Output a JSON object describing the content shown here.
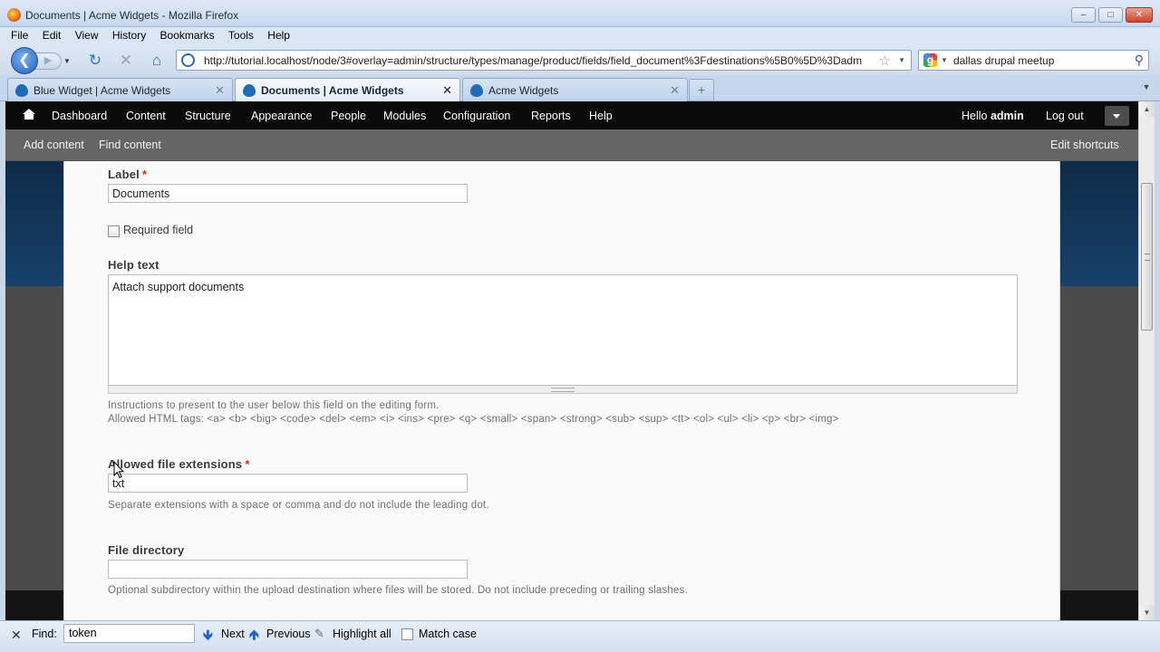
{
  "window": {
    "title": "Documents | Acme Widgets - Mozilla Firefox",
    "controls": [
      "–",
      "□",
      "✕"
    ]
  },
  "menubar": [
    "File",
    "Edit",
    "View",
    "History",
    "Bookmarks",
    "Tools",
    "Help"
  ],
  "navbar": {
    "url": "http://tutorial.localhost/node/3#overlay=admin/structure/types/manage/product/fields/field_document%3Fdestinations%5B0%5D%3Dadm",
    "search_text": "dallas drupal meetup"
  },
  "tabs": [
    {
      "label": "Blue Widget | Acme Widgets",
      "active": false
    },
    {
      "label": "Documents | Acme Widgets",
      "active": true
    },
    {
      "label": "Acme Widgets",
      "active": false
    }
  ],
  "admin_toolbar": {
    "items": [
      "Dashboard",
      "Content",
      "Structure",
      "Appearance",
      "People",
      "Modules",
      "Configuration",
      "Reports",
      "Help"
    ],
    "hello_prefix": "Hello ",
    "username": "admin",
    "logout": "Log out"
  },
  "shortcuts": {
    "items": [
      "Add content",
      "Find content"
    ],
    "edit": "Edit shortcuts"
  },
  "form": {
    "label_title": "Label",
    "label_value": "Documents",
    "required_field_label": "Required field",
    "help_text_title": "Help text",
    "help_text_value": "Attach support documents",
    "help_desc_line1": "Instructions to present to the user below this field on the editing form.",
    "help_desc_line2": "Allowed HTML tags: <a> <b> <big> <code> <del> <em> <i> <ins> <pre> <q> <small> <span> <strong> <sub> <sup> <tt> <ol> <ul> <li> <p> <br> <img>",
    "extensions_title": "Allowed file extensions",
    "extensions_value": "txt",
    "extensions_desc": "Separate extensions with a space or comma and do not include the leading dot.",
    "directory_title": "File directory",
    "directory_value": "",
    "directory_desc": "Optional subdirectory within the upload destination where files will be stored. Do not include preceding or trailing slashes.",
    "required_marker": "*"
  },
  "findbar": {
    "label": "Find:",
    "query": "token",
    "next": "Next",
    "previous": "Previous",
    "highlight": "Highlight all",
    "match_case": "Match case"
  },
  "colors": {
    "toolbar_bg": "#0a0a0a",
    "shortcut_bg": "#656565",
    "required": "#e0271f"
  }
}
